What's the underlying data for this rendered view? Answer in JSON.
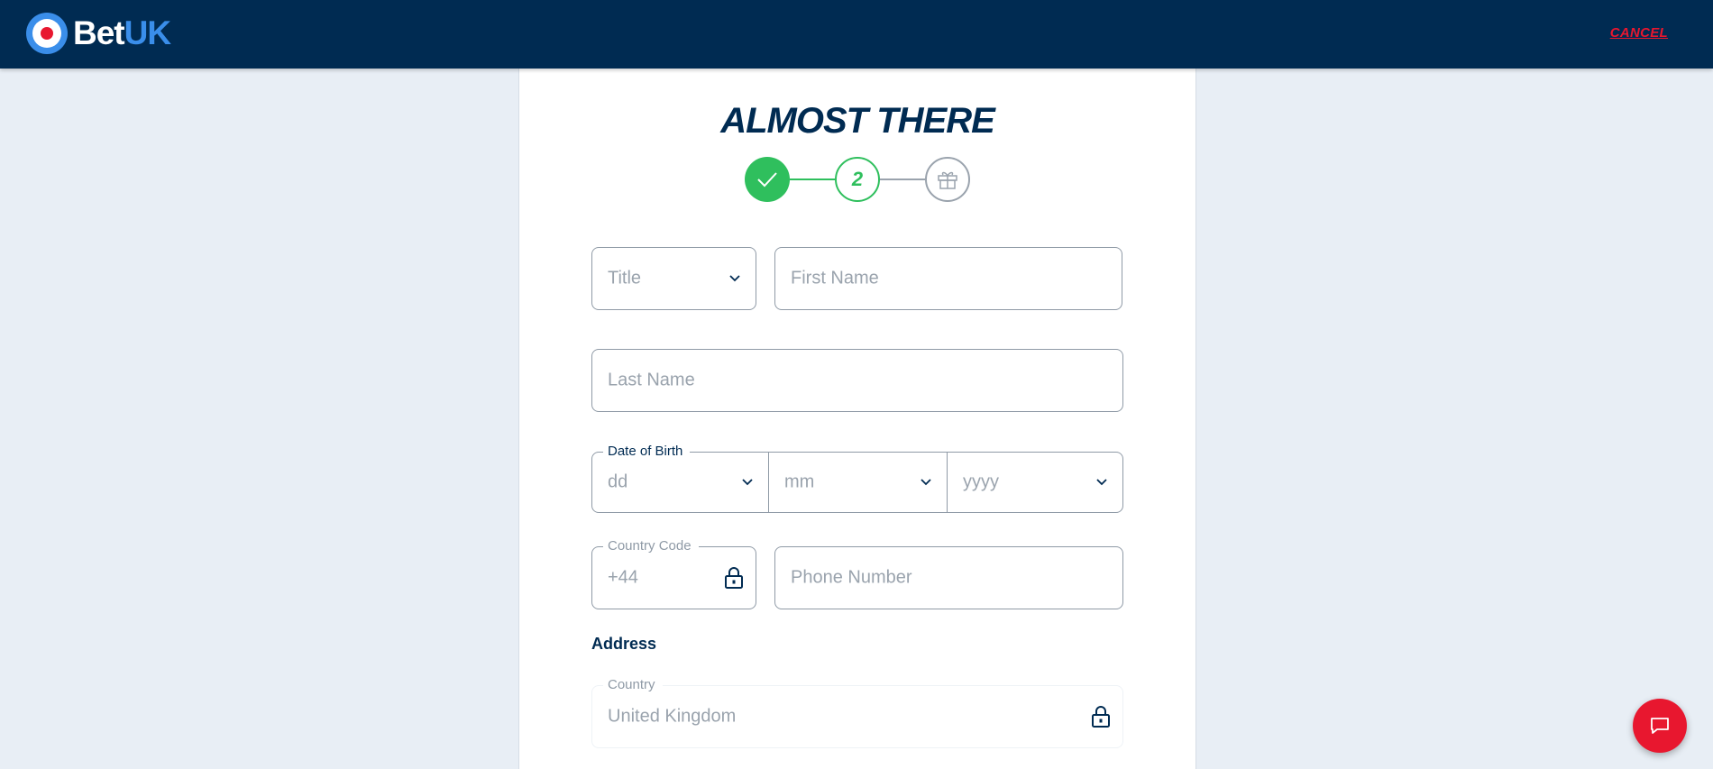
{
  "header": {
    "logo_text_1": "Bet",
    "logo_text_2": "UK",
    "cancel_label": "CANCEL"
  },
  "page": {
    "title": "ALMOST THERE"
  },
  "stepper": {
    "step2_label": "2",
    "completed_icon": "check-icon",
    "final_icon": "gift-icon"
  },
  "form": {
    "title_placeholder": "Title",
    "first_name_placeholder": "First Name",
    "last_name_placeholder": "Last Name",
    "dob_legend": "Date of Birth",
    "dob_day_placeholder": "dd",
    "dob_month_placeholder": "mm",
    "dob_year_placeholder": "yyyy",
    "country_code_legend": "Country Code",
    "country_code_value": "+44",
    "phone_placeholder": "Phone Number",
    "address_heading": "Address",
    "country_legend": "Country",
    "country_value": "United Kingdom"
  },
  "colors": {
    "navy": "#002b52",
    "accent_blue": "#3a8eea",
    "red": "#e8172f",
    "green": "#2fbf5d"
  }
}
